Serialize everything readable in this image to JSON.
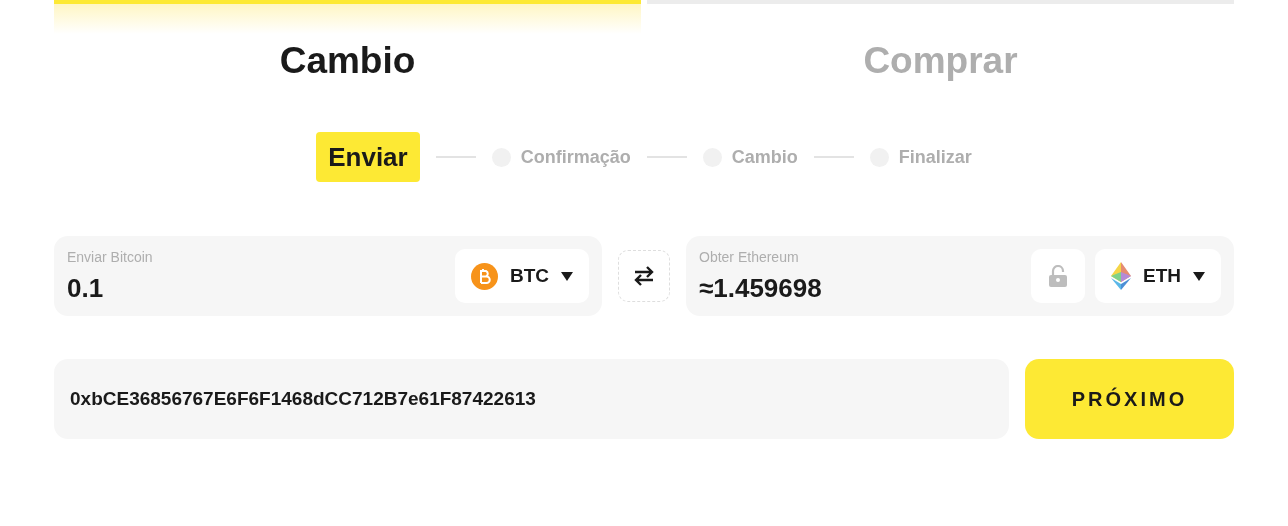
{
  "tabs": [
    {
      "label": "Cambio",
      "selected": true
    },
    {
      "label": "Comprar",
      "selected": false
    }
  ],
  "steps": [
    {
      "label": "Enviar",
      "selected": true
    },
    {
      "label": "Confirmação",
      "selected": false
    },
    {
      "label": "Cambio",
      "selected": false
    },
    {
      "label": "Finalizar",
      "selected": false
    }
  ],
  "send": {
    "label": "Enviar Bitcoin",
    "value": "0.1",
    "currency": "BTC"
  },
  "receive": {
    "label": "Obter Ethereum",
    "value": "≈1.459698",
    "currency": "ETH"
  },
  "address": {
    "value": "0xbCE36856767E6F6F1468dCC712B7e61F87422613"
  },
  "next_button": "PRÓXIMO"
}
